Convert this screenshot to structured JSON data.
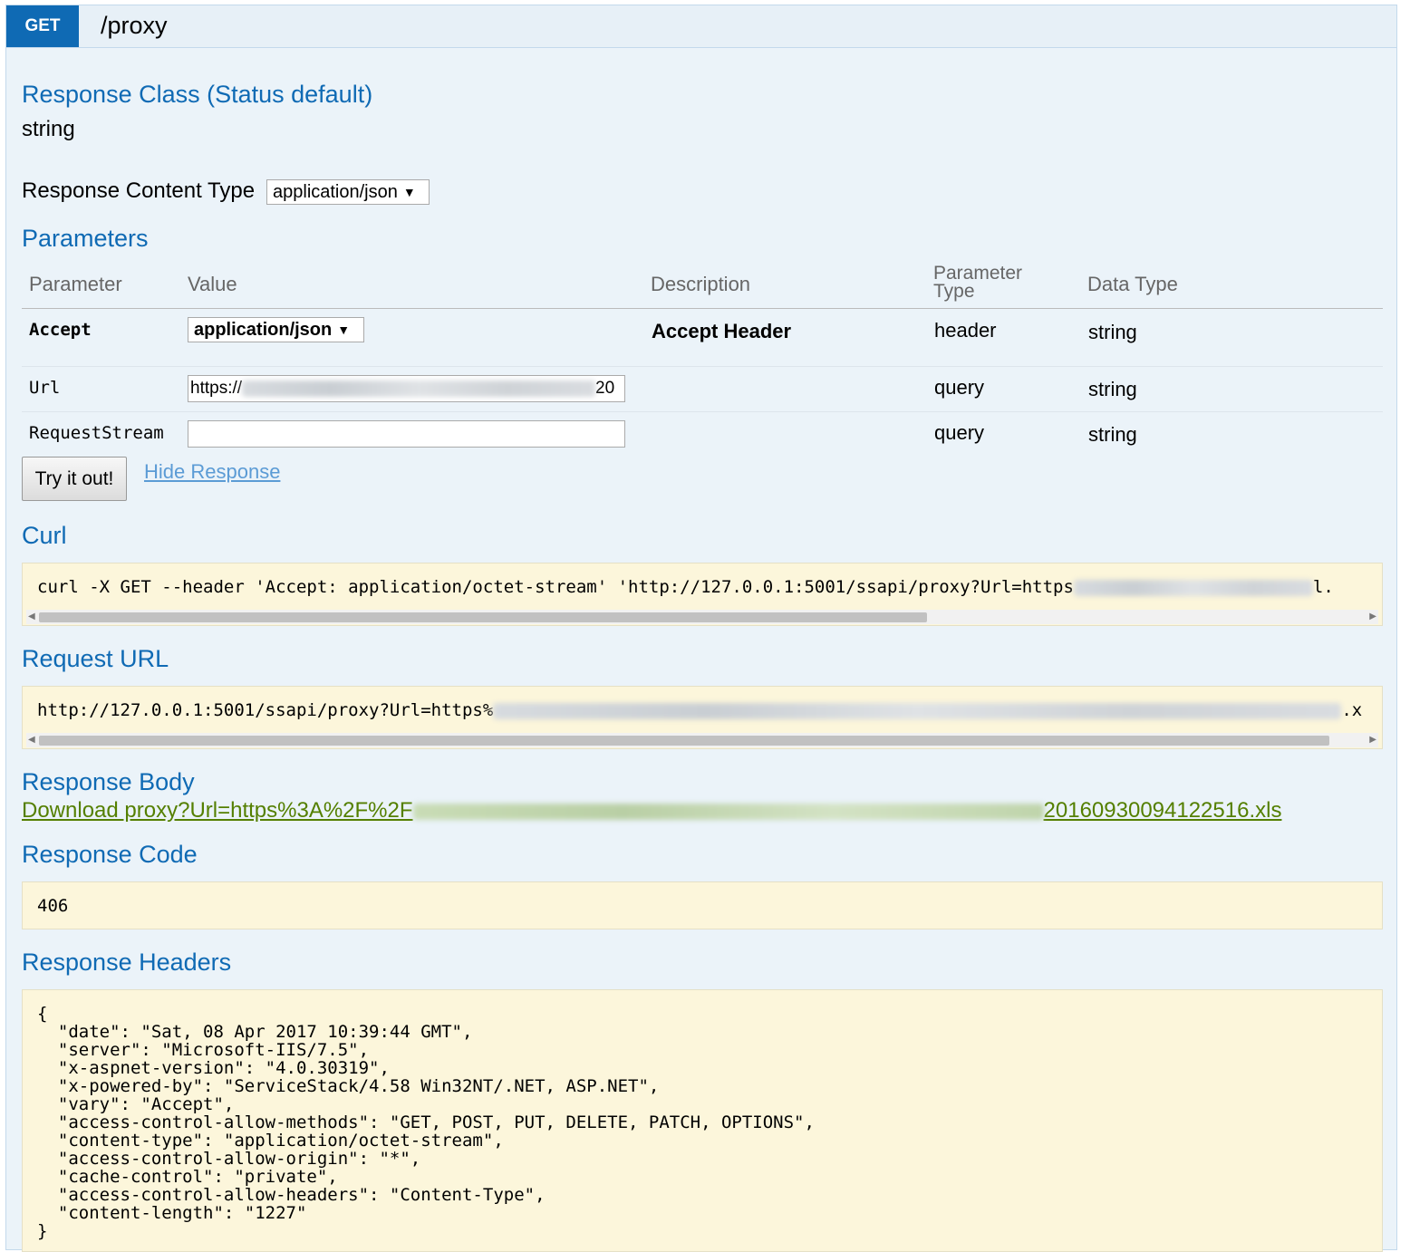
{
  "operation": {
    "method": "GET",
    "path": "/proxy"
  },
  "response_class": {
    "title": "Response Class (Status default)",
    "type": "string"
  },
  "response_content_type": {
    "label": "Response Content Type",
    "selected": "application/json"
  },
  "parameters": {
    "title": "Parameters",
    "headers": {
      "parameter": "Parameter",
      "value": "Value",
      "description": "Description",
      "parameter_type": "Parameter Type",
      "data_type": "Data Type"
    },
    "rows": [
      {
        "name": "Accept",
        "value": "application/json",
        "description": "Accept Header",
        "param_type": "header",
        "data_type": "string"
      },
      {
        "name": "Url",
        "value_prefix": "https://",
        "value_suffix": "20",
        "description": "",
        "param_type": "query",
        "data_type": "string"
      },
      {
        "name": "RequestStream",
        "value": "",
        "description": "",
        "param_type": "query",
        "data_type": "string"
      }
    ]
  },
  "actions": {
    "try_label": "Try it out!",
    "hide_label": "Hide Response"
  },
  "curl": {
    "title": "Curl",
    "command": "curl -X GET --header 'Accept: application/octet-stream' 'http://127.0.0.1:5001/ssapi/proxy?Url=https",
    "tail": "l."
  },
  "request_url": {
    "title": "Request URL",
    "url": "http://127.0.0.1:5001/ssapi/proxy?Url=https%",
    "tail": ".x"
  },
  "response_body": {
    "title": "Response Body",
    "link_prefix": "Download proxy?Url=https%3A%2F%2F",
    "link_suffix": "20160930094122516.xls"
  },
  "response_code": {
    "title": "Response Code",
    "value": "406"
  },
  "response_headers": {
    "title": "Response Headers",
    "json_text": "{\n  \"date\": \"Sat, 08 Apr 2017 10:39:44 GMT\",\n  \"server\": \"Microsoft-IIS/7.5\",\n  \"x-aspnet-version\": \"4.0.30319\",\n  \"x-powered-by\": \"ServiceStack/4.58 Win32NT/.NET, ASP.NET\",\n  \"vary\": \"Accept\",\n  \"access-control-allow-methods\": \"GET, POST, PUT, DELETE, PATCH, OPTIONS\",\n  \"content-type\": \"application/octet-stream\",\n  \"access-control-allow-origin\": \"*\",\n  \"cache-control\": \"private\",\n  \"access-control-allow-headers\": \"Content-Type\",\n  \"content-length\": \"1227\"\n}"
  },
  "colors": {
    "method_badge": "#0f6ab4",
    "section_title": "#0f6ab4",
    "panel_bg": "#ebf3f9",
    "code_bg": "#fcf6db",
    "download_link": "#547f00"
  }
}
